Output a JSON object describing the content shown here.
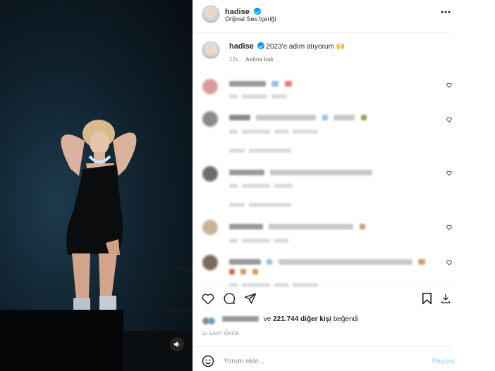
{
  "header": {
    "username": "hadise",
    "audio": "Orijinal Ses İçeriği",
    "more_icon": "more-horizontal-icon"
  },
  "caption": {
    "username": "hadise",
    "text": "2023'e adım atıyorum",
    "emoji": "🙌",
    "time": "12s",
    "translate": "Aslına bak"
  },
  "actions": {
    "like_icon": "heart-icon",
    "comment_icon": "comment-icon",
    "share_icon": "send-icon",
    "save_icon": "bookmark-icon",
    "download_icon": "download-icon"
  },
  "likes": {
    "prefix": "ve",
    "count": "221.744 diğer kişi",
    "suffix": "beğendi"
  },
  "timestamp": "12 SAAT ÖNCE",
  "comment_box": {
    "placeholder": "Yorum ekle...",
    "post_label": "Paylaş",
    "emoji_icon": "smiley-icon"
  },
  "media": {
    "volume_icon": "speaker-icon"
  },
  "colors": {
    "verified": "#0095f6",
    "post_disabled": "#b2dffc",
    "muted": "#8e8e8e"
  }
}
